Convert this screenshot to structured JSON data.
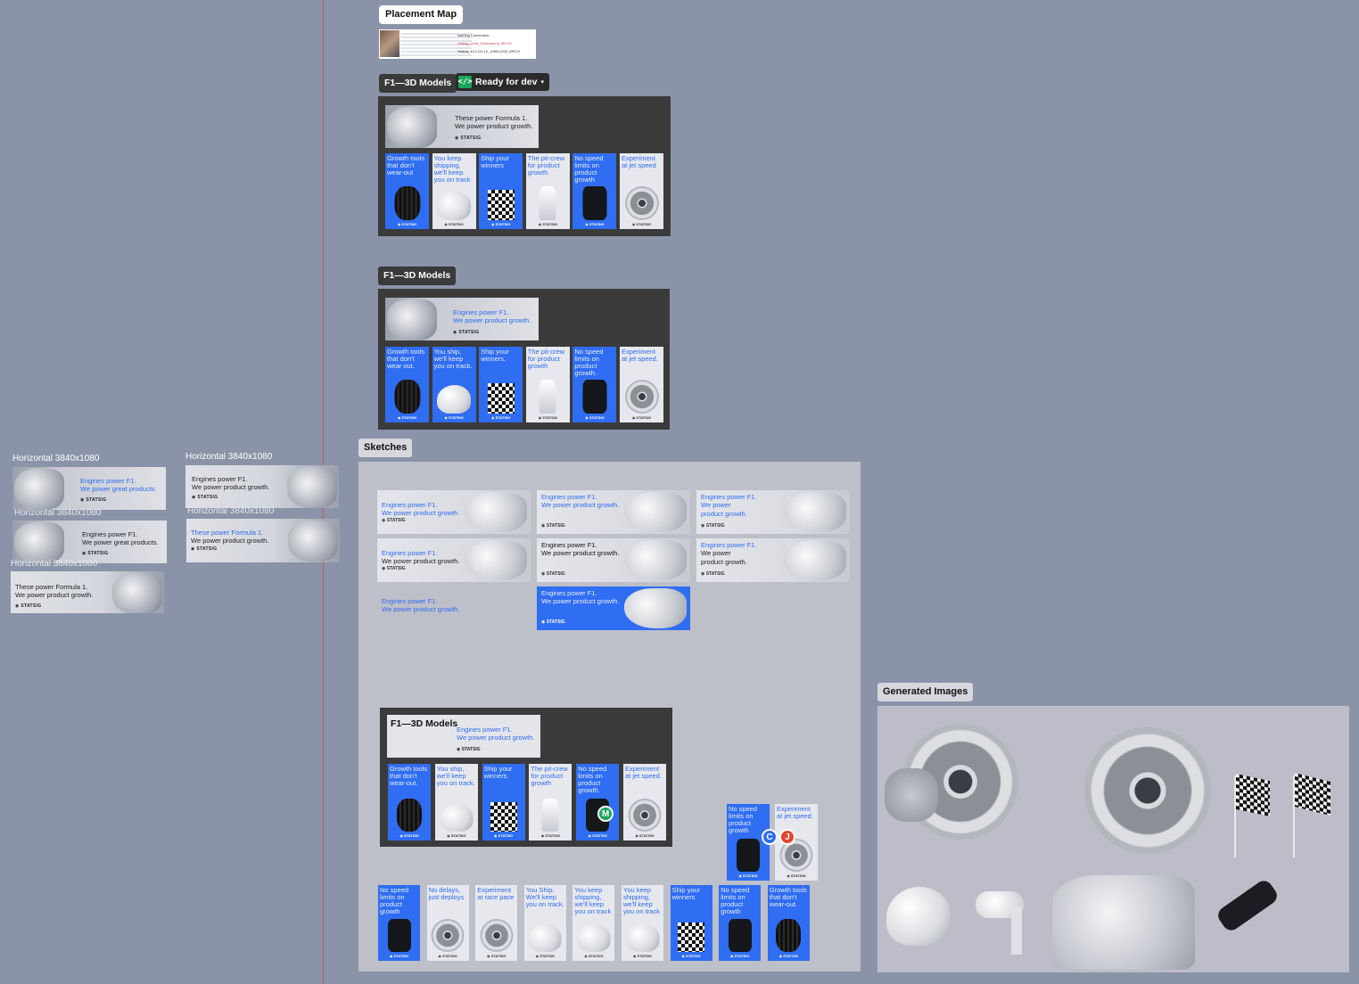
{
  "placement_map": {
    "title": "Placement Map",
    "naming_title": "Naming Convention:",
    "naming_line1": "Statsig_Units_Dimensions_MECH",
    "naming_line2": "Statsig_10-LCD-10_1080x1920_MECH"
  },
  "frame1": {
    "title": "F1—3D Models",
    "dev_status": "Ready for dev",
    "banner_line1": "These power Formula 1.",
    "banner_line2": "We power product growth.",
    "logo": "STATSIG",
    "tiles": [
      {
        "text": "Growth tools that don't wear-out",
        "style": "blue",
        "obj": "tyre"
      },
      {
        "text": "You keep shipping, we'll keep you on track",
        "style": "white",
        "obj": "helmet"
      },
      {
        "text": "Ship your winners",
        "style": "blue",
        "obj": "flag"
      },
      {
        "text": "The pit-crew for product growth",
        "style": "white",
        "obj": "gun"
      },
      {
        "text": "No speed limits on product growth",
        "style": "blue",
        "obj": "car"
      },
      {
        "text": "Experiment at jet speed",
        "style": "white",
        "obj": "jet"
      }
    ]
  },
  "frame2": {
    "title": "F1—3D Models",
    "banner_line1": "Engines power F1.",
    "banner_line2": "We power product growth.",
    "logo": "STATSIG",
    "tiles": [
      {
        "text": "Growth tools that don't wear out.",
        "style": "blue",
        "obj": "tyre"
      },
      {
        "text": "You ship, we'll keep you on track.",
        "style": "blue",
        "obj": "helmet"
      },
      {
        "text": "Ship your winners.",
        "style": "blue",
        "obj": "flag"
      },
      {
        "text": "The pit-crew for product growth",
        "style": "white",
        "obj": "gun"
      },
      {
        "text": "No speed limits on product growth.",
        "style": "blue",
        "obj": "car"
      },
      {
        "text": "Experiment at jet speed.",
        "style": "white",
        "obj": "jet"
      }
    ]
  },
  "left_banners": {
    "label": "Horizontal 3840x1080",
    "a1": {
      "l1": "Engines power F1.",
      "l2": "We power great products."
    },
    "a2": {
      "l1": "Engines power F1.",
      "l2": "We power great products."
    },
    "a3": {
      "l1": "These power Formula 1.",
      "l2": "We power product growth."
    },
    "b1": {
      "l1": "Engines power F1.",
      "l2": "We power product growth."
    },
    "b2": {
      "l1": "These power Formula 1.",
      "l2": "We power product growth."
    },
    "logo": "STATSIG"
  },
  "sketches": {
    "title": "Sketches",
    "items": [
      {
        "l1": "Engines power F1.",
        "l2": "We power product growth.",
        "variant": "light"
      },
      {
        "l1": "Engines power F1.",
        "l2": "We power product growth.",
        "variant": "light"
      },
      {
        "l1": "Engines power F1.",
        "l2": "We power",
        "l3": "product growth.",
        "variant": "light"
      },
      {
        "l1": "Engines power F1.",
        "l2": "We power product growth.",
        "variant": "dark-line2"
      },
      {
        "l1": "Engines power F1.",
        "l2": "We power product growth.",
        "variant": "black"
      },
      {
        "l1": "Engines power F1.",
        "l2": "We power",
        "l3": "product growth.",
        "variant": "dark-line2"
      },
      {
        "l1": "Engines power F1.",
        "l2": "We power product growth.",
        "variant": "text-only"
      },
      {
        "l1": "Engines power F1.",
        "l2": "We power product growth.",
        "variant": "blue"
      }
    ],
    "logo": "STATSIG",
    "inner_frame_title": "F1—3D Models",
    "inner_banner_l1": "Engines power F1.",
    "inner_banner_l2": "We power product growth.",
    "inner_tiles": [
      {
        "text": "Growth tools that don't wear-out.",
        "style": "blue",
        "obj": "tyre"
      },
      {
        "text": "You ship, we'll keep you on track.",
        "style": "white",
        "obj": "helmet"
      },
      {
        "text": "Ship your winners.",
        "style": "blue",
        "obj": "flag"
      },
      {
        "text": "The pit-crew for product growth",
        "style": "white",
        "obj": "gun"
      },
      {
        "text": "No speed limits on product growth.",
        "style": "blue",
        "obj": "car"
      },
      {
        "text": "Experiment at jet speed.",
        "style": "white",
        "obj": "jet"
      }
    ],
    "float_tiles": [
      {
        "text": "No speed limits on product growth",
        "style": "blue",
        "obj": "car"
      },
      {
        "text": "Experiment at jet speed.",
        "style": "white",
        "obj": "jet"
      }
    ],
    "bottom_tiles": [
      {
        "text": "No speed limits on product growth",
        "style": "blue",
        "obj": "car"
      },
      {
        "text": "No delays, just deploys",
        "style": "white",
        "obj": "jet"
      },
      {
        "text": "Experiment at race pace",
        "style": "white",
        "obj": "jet"
      },
      {
        "text": "You Ship. We'll keep you on track.",
        "style": "white",
        "obj": "helmet"
      },
      {
        "text": "You keep shipping, we'll keep you on track",
        "style": "white",
        "obj": "helmet"
      },
      {
        "text": "You keep shipping, we'll keep you on track",
        "style": "white",
        "obj": "helmet"
      },
      {
        "text": "Ship your winners",
        "style": "blue",
        "obj": "flag"
      },
      {
        "text": "No speed limits on product growth",
        "style": "blue",
        "obj": "car"
      },
      {
        "text": "Growth tools that don't wear-out.",
        "style": "blue",
        "obj": "tyre"
      }
    ],
    "avatars": [
      {
        "letter": "M",
        "color": "#1aa55a"
      },
      {
        "letter": "C",
        "color": "#2f6df2"
      },
      {
        "letter": "J",
        "color": "#e0452f"
      }
    ]
  },
  "generated": {
    "title": "Generated Images"
  }
}
